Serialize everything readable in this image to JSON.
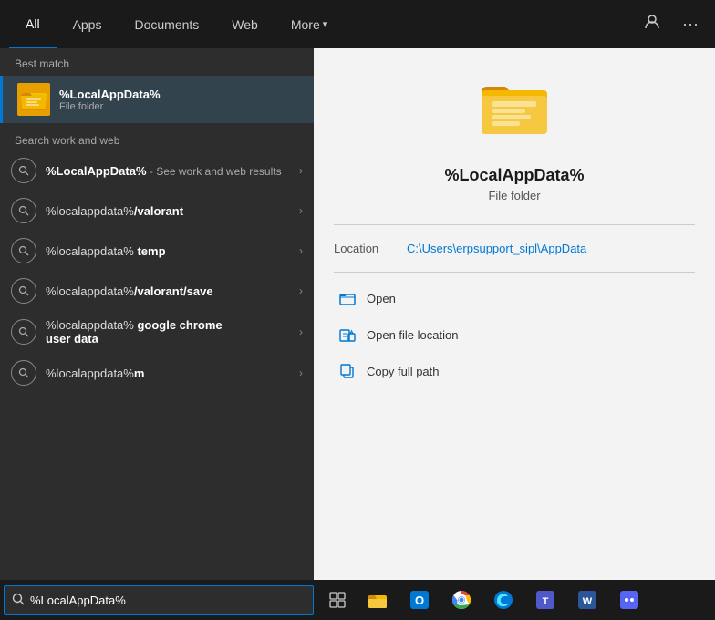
{
  "nav": {
    "tabs": [
      {
        "id": "all",
        "label": "All",
        "active": true
      },
      {
        "id": "apps",
        "label": "Apps"
      },
      {
        "id": "documents",
        "label": "Documents"
      },
      {
        "id": "web",
        "label": "Web"
      },
      {
        "id": "more",
        "label": "More",
        "hasArrow": true
      }
    ],
    "icon_person": "👤",
    "icon_more": "···"
  },
  "left": {
    "best_match_label": "Best match",
    "best_match": {
      "title": "%LocalAppData%",
      "subtitle": "File folder"
    },
    "search_work_label": "Search work and web",
    "results": [
      {
        "text_before": "%LocalAppData%",
        "text_after": " - See work and web results",
        "bold": false,
        "multi": true
      },
      {
        "text_plain": "%localappdata%",
        "text_bold": "/valorant",
        "text_after": ""
      },
      {
        "text_plain": "%localappdata% ",
        "text_bold": "temp",
        "text_after": ""
      },
      {
        "text_plain": "%localappdata%",
        "text_bold": "/valorant/save",
        "text_after": ""
      },
      {
        "text_plain": "%localappdata% ",
        "text_bold": "google chrome user data",
        "text_after": "",
        "multiline": "user data"
      },
      {
        "text_plain": "%localappdata%",
        "text_bold": "m",
        "text_after": ""
      }
    ]
  },
  "right": {
    "folder_title": "%LocalAppData%",
    "folder_type": "File folder",
    "location_label": "Location",
    "location_path": "C:\\Users\\erpsupport_sipl\\AppData",
    "actions": [
      {
        "label": "Open",
        "icon": "folder_open"
      },
      {
        "label": "Open file location",
        "icon": "folder_location"
      },
      {
        "label": "Copy full path",
        "icon": "copy"
      }
    ]
  },
  "taskbar": {
    "search_value": "%LocalAppData%",
    "search_placeholder": "%LocalAppData%"
  }
}
